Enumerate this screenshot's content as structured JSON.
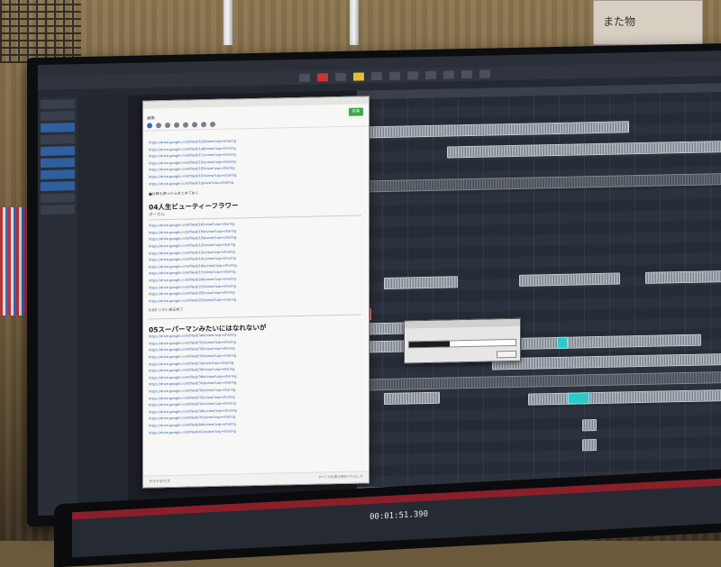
{
  "memo": {
    "title": "",
    "editing_label": "編集",
    "share_label": "共有",
    "section_question": "■以降も使ったらまとめておく",
    "heading_04": "04人生ビューティーフラワー",
    "subheading_04": "ボーカル",
    "misc_line": "0:00 リスト修正完了",
    "heading_05": "05スーパーマンみたいにはなれないが",
    "footer_left": "ラウドボイス",
    "footer_right": "すべての変更が保存されました"
  },
  "daw": {
    "dialog_title": "",
    "dialog_text": "",
    "progress_percent": 38,
    "progress_label": "38%",
    "cancel_label": ""
  },
  "laptop": {
    "counter": "00:01:51.390"
  },
  "room": {
    "box_label": "また物"
  }
}
